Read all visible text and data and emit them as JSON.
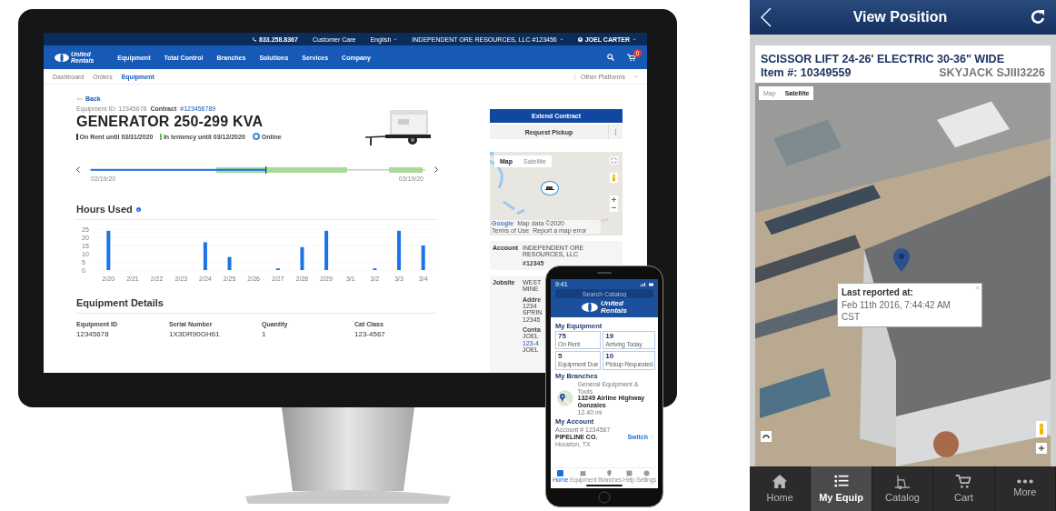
{
  "monitor": {
    "top_bar": {
      "phone": "833.258.8367",
      "links": [
        "Customer Care",
        "English"
      ],
      "account": "INDEPENDENT ORE RESOURCES, LLC #123456",
      "user": "JOEL CARTER"
    },
    "nav": {
      "logo": [
        "United",
        "Rentals"
      ],
      "items": [
        "Equipment",
        "Total Control",
        "Branches",
        "Solutions",
        "Services",
        "Company"
      ],
      "cart_badge": "0"
    },
    "subnav": {
      "tabs": [
        {
          "label": "Dashboard",
          "selected": false
        },
        {
          "label": "Orders",
          "selected": false
        },
        {
          "label": "Equipment",
          "selected": true
        }
      ],
      "other": "Other Platforms"
    },
    "back": "Back",
    "equipment_id": "Equipment ID: 12345678",
    "contract_label": "Contract",
    "contract_link": "#123456789",
    "title": "GENERATOR 250-299 KVA",
    "statuses": [
      {
        "text": "On Rent until 03/31/2020",
        "kind": "bar",
        "color": "#333333"
      },
      {
        "text": "In leniency until 03/12/2020",
        "kind": "bar",
        "color": "#5cc35c"
      },
      {
        "text": "Online",
        "kind": "ring",
        "color": "#3b8de0"
      }
    ],
    "timeline": {
      "start": "02/19/20",
      "end": "03/19/20"
    },
    "hours": {
      "title": "Hours Used",
      "chart_data": {
        "type": "bar",
        "categories": [
          "2/20",
          "2/21",
          "2/22",
          "2/23",
          "2/24",
          "2/25",
          "2/26",
          "2/27",
          "2/28",
          "2/29",
          "3/1",
          "3/2",
          "3/3",
          "3/4"
        ],
        "series": [
          {
            "color": "#1a73e8",
            "values": [
              24,
              0,
              0,
              0,
              17,
              8,
              0,
              1,
              14,
              24,
              0,
              1,
              24,
              15
            ]
          }
        ],
        "ylim": [
          0,
          25
        ],
        "yticks": [
          0,
          5,
          10,
          15,
          20,
          25
        ]
      }
    },
    "details": {
      "title": "Equipment Details",
      "fields": [
        {
          "label": "Equipment ID",
          "value": "12345678"
        },
        {
          "label": "Serial Number",
          "value": "1X3DR90GH61"
        },
        {
          "label": "Quantity",
          "value": "1"
        },
        {
          "label": "Cat Class",
          "value": "123-4567"
        }
      ]
    },
    "actions": [
      "Extend Contract",
      "Request Pickup"
    ],
    "map": {
      "types": [
        {
          "label": "Map",
          "selected": true
        },
        {
          "label": "Satellite",
          "selected": false
        }
      ],
      "logo": "Google",
      "footer": [
        "Map data ©2020",
        "Terms of Use",
        "Report a map error"
      ]
    },
    "account": {
      "label": "Account",
      "name": "INDEPENDENT ORE RESOURCES, LLC",
      "number": "#12345"
    },
    "jobsite": {
      "label": "Jobsite",
      "lines": [
        "WEST",
        "MINE"
      ],
      "address_label": "Addre",
      "address": [
        "1234",
        "SPRIN",
        "12345"
      ],
      "contact_label": "Conta",
      "contact": [
        "JOEL",
        "123-4",
        "JOEL"
      ]
    }
  },
  "phone": {
    "time": "9:41",
    "search": {
      "placeholder": "Search Catalog"
    },
    "logo": [
      "United",
      "Rentals"
    ],
    "equipment_title": "My Equipment",
    "tiles": [
      {
        "count": "75",
        "label": "On Rent"
      },
      {
        "count": "19",
        "label": "Arriving Today"
      },
      {
        "count": "5",
        "label": "Equipment Due"
      },
      {
        "count": "10",
        "label": "Pickup Requested"
      }
    ],
    "branches_title": "My Branches",
    "branch": {
      "type": "General Equipment & Tools",
      "address": "13249 Airline Highway",
      "city": "Gonzales",
      "distance": "12.40 mi"
    },
    "account_title": "My Account",
    "account": {
      "number": "Account # 1234567",
      "name": "PIPELINE CO.",
      "city": "Houston, TX",
      "action": "Switch"
    },
    "tabs": [
      {
        "label": "Home",
        "selected": true
      },
      {
        "label": "Equipment",
        "selected": false
      },
      {
        "label": "Branches",
        "selected": false
      },
      {
        "label": "Help",
        "selected": false
      },
      {
        "label": "Settings",
        "selected": false
      }
    ]
  },
  "mobile_app": {
    "title": "View Position",
    "item_name": "SCISSOR LIFT 24-26' ELECTRIC 30-36\" WIDE",
    "item_number": "Item #: 10349559",
    "model": "SKYJACK SJIII3226",
    "map_types": [
      {
        "label": "Map",
        "selected": false
      },
      {
        "label": "Satellite",
        "selected": true
      }
    ],
    "popup": {
      "title": "Last reported at:",
      "text": "Feb 11th 2016, 7:44:42 AM CST"
    },
    "tabs": [
      {
        "label": "Home",
        "selected": false
      },
      {
        "label": "My Equip",
        "selected": true
      },
      {
        "label": "Catalog",
        "selected": false
      },
      {
        "label": "Cart",
        "selected": false
      },
      {
        "label": "More",
        "selected": false
      }
    ]
  }
}
